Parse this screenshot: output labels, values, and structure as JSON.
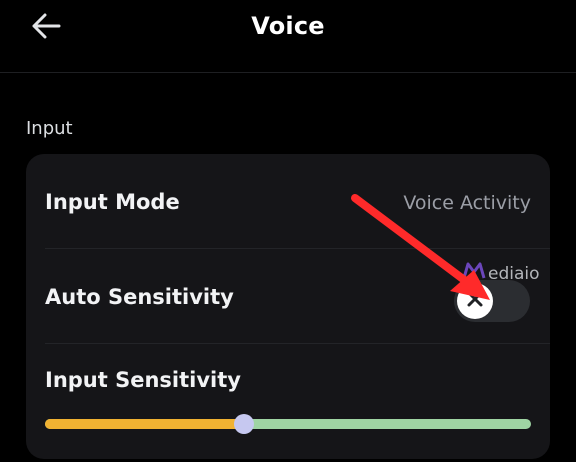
{
  "header": {
    "title": "Voice",
    "back_icon": "arrow-left-icon"
  },
  "section": {
    "label": "Input"
  },
  "input_mode": {
    "label": "Input Mode",
    "value": "Voice Activity"
  },
  "auto_sensitivity": {
    "label": "Auto Sensitivity",
    "enabled": false,
    "knob_icon": "close-icon"
  },
  "input_sensitivity": {
    "label": "Input Sensitivity",
    "level_fraction": 0.41
  },
  "watermark": {
    "text": "ediaio"
  },
  "colors": {
    "background": "#000000",
    "card": "#151518",
    "slider_below": "#f0b232",
    "slider_above": "#9fd4a3",
    "thumb": "#c6c8f0",
    "annotation_arrow": "#ff2a2a"
  }
}
